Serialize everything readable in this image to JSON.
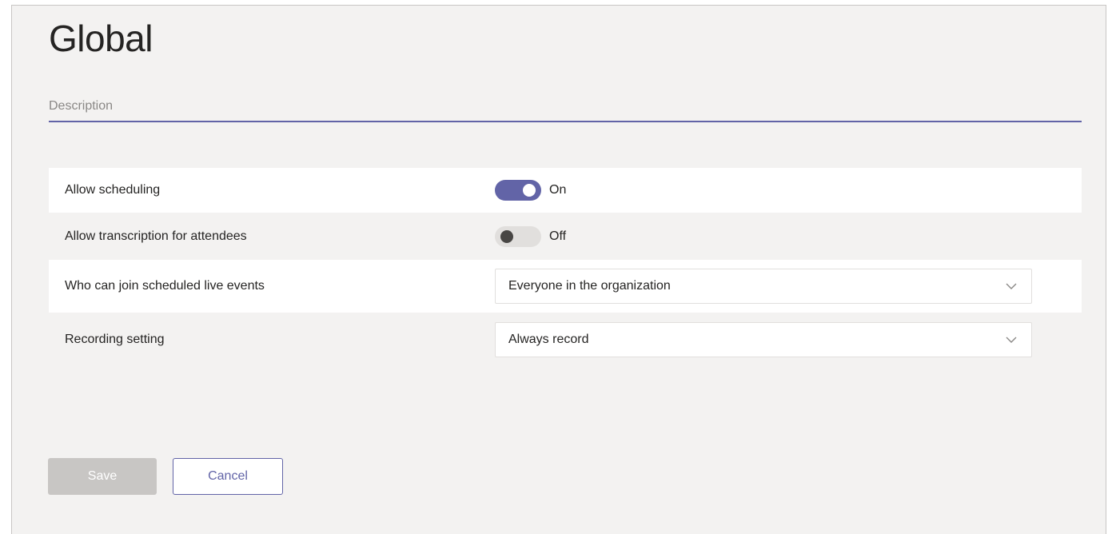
{
  "page": {
    "title": "Global"
  },
  "description": {
    "placeholder": "Description",
    "value": ""
  },
  "settings": [
    {
      "label": "Allow scheduling",
      "type": "toggle",
      "state": "On",
      "enabled": true
    },
    {
      "label": "Allow transcription for attendees",
      "type": "toggle",
      "state": "Off",
      "enabled": false
    },
    {
      "label": "Who can join scheduled live events",
      "type": "dropdown",
      "value": "Everyone in the organization"
    },
    {
      "label": "Recording setting",
      "type": "dropdown",
      "value": "Always record"
    }
  ],
  "actions": {
    "save_label": "Save",
    "cancel_label": "Cancel"
  },
  "icons": {
    "dropdown": "chevron-down-icon"
  },
  "colors": {
    "accent": "#6264a7",
    "background": "#f3f2f1",
    "row_alt": "#ffffff",
    "disabled_button": "#c8c6c4",
    "toggle_off_track": "#e1dfdd",
    "toggle_off_knob": "#484644"
  }
}
